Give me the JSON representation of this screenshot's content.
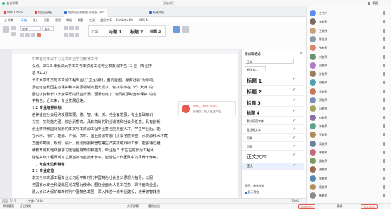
{
  "meeting_bar": {
    "left": "会议详情",
    "center_status": "正在讲话：",
    "right_label": "视图"
  },
  "wps_tabs": [
    {
      "label": "WPS Office",
      "color": "#e34a3b",
      "active": false
    },
    {
      "label": "找稻壳模板",
      "color": "#e34a3b",
      "active": false
    },
    {
      "label": "地质与资源勘查(评估版).doc",
      "color": "#2b6bd6",
      "active": true
    },
    {
      "label": "新建文档",
      "color": "#2b6bd6",
      "active": false
    }
  ],
  "menu": [
    "三 文件",
    "开始",
    "插入",
    "页面",
    "引用",
    "审阅",
    "视图",
    "工具",
    "会员专享",
    "EndNote X9",
    "WPS AI"
  ],
  "toolbar": {
    "font": "宋体",
    "size": "五号"
  },
  "document": {
    "lines": [
      "中華鉴定审议中心提高专业学习教育工作",
      "设点。2023 年长江大学本文与本资源工程专业校友会排名 12 位（专业排",
      "名 B++）",
      "长江大学本文与本资源工程专业以“立足湖北，面向全国，服务社会”为导向，",
      "紧密结合我国生态保护和本资源领域的重大需求，依托学校在“长江大洲”的",
      "区位优势和长江大学深厚的行业背景，逐渐形成了“地质资源勘查与保护”的办",
      "学特色。近年来，专业发展迅速。",
      "1.2 专业培养目标",
      "培养适应社会经济发展需要，德、智、体、美、劳全面发展，专业基础知识",
      "扎实、实践能力强，综合素质高，具有高尚的职业道德和社会责任感，具有创新",
      "创业精神和国际视野的本文与本资源工程专业复合应用型人才。学生毕业后，能",
      "在水利、地矿、能源、环保、农林、国土资源等部门从事地质调查、水资源和水环境",
      "方面的勘测、规划、设计、预测预报和管理等生产实践或科研工作；能够通过继",
      "续教育或其他终身学习途径拓展知识和能力，毕业后 5 年左右成长为工程师",
      "胜任高级工程师或与之相当的专业技术水平，能胜任工作团队中发挥骨干作用。",
      "二、专业定位和特色",
      "2.1 专业定位",
      "本文与本资源工程专业以习近平新时代中国特色社会主义思想为指导，以服",
      "务国家水安全和湖北区域发展为使命，围绕全面树人根本任务，秉持面向业业，",
      "融入长江大保护和新时代中国特色发展，深入推进一流专业建设，培养德智体美"
    ]
  },
  "comment": {
    "user": "WPS_1680316953",
    "text": "好建议，插入批注内容"
  },
  "styles_pane": {
    "title": "样式和格式",
    "current": "正文",
    "new_style": "新样式...",
    "items": [
      {
        "label": "标题 1"
      },
      {
        "label": "标题 2"
      },
      {
        "label": "标题 3"
      },
      {
        "label": "标题 4"
      },
      {
        "label": "默认段落字体"
      },
      {
        "label": "批注框文本"
      },
      {
        "label": "页脚"
      },
      {
        "label": "页眉"
      },
      {
        "label": "正文文本"
      },
      {
        "label": "正文"
      }
    ],
    "show_label": "显示：有效样式",
    "preview_label": "显示预览"
  },
  "status": {
    "left": "页面: 1/11",
    "words": "字数: 7438",
    "zoom": "100%"
  },
  "participants": [
    {
      "name": "主持人",
      "color": "#5b8def"
    },
    {
      "name": "李老师",
      "color": "#7c6b5d"
    },
    {
      "name": "王教授",
      "color": "#c9a27a"
    },
    {
      "name": "陈主任",
      "color": "#8a9ba8"
    },
    {
      "name": "张老师",
      "color": "#d48a6a"
    },
    {
      "name": "刘老师",
      "color": "#6b8f71"
    },
    {
      "name": "赵老师",
      "color": "#b07cc6"
    },
    {
      "name": "孙老师",
      "color": "#9b7b5a"
    },
    {
      "name": "周老师",
      "color": "#4f9fb5"
    },
    {
      "name": "吴老师",
      "color": "#c7755f"
    },
    {
      "name": "郑老师",
      "color": "#7a8fb8"
    },
    {
      "name": "冯老师",
      "color": "#a3a35c"
    },
    {
      "name": "何老师",
      "color": "#8c6fa8"
    },
    {
      "name": "许老师",
      "color": "#5fa38c"
    },
    {
      "name": "罗老师",
      "color": "#b58a5a"
    },
    {
      "name": "高老师",
      "color": "#6d7f99"
    },
    {
      "name": "林老师",
      "color": "#c46b7a"
    },
    {
      "name": "梁老师",
      "color": "#7d9c5f"
    },
    {
      "name": "谢老师",
      "color": "#9a6b4f"
    },
    {
      "name": "宋老师",
      "color": "#5a84b3"
    },
    {
      "name": "唐老师",
      "color": "#b3905a"
    },
    {
      "name": "韩老师",
      "color": "#8b8b8b"
    }
  ],
  "controls": {
    "mute": "解除静音",
    "video": "开启视频",
    "share": "共享屏幕",
    "members": "管理成员",
    "end": "结束会议",
    "invite": "邀请",
    "leave": "离开会议"
  }
}
